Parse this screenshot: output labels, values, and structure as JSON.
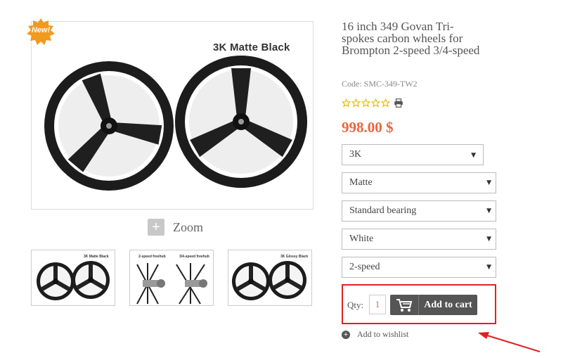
{
  "badge": {
    "label": "New!",
    "color": "#f29a1f"
  },
  "main_image": {
    "caption": "3K Matte Black"
  },
  "zoom": {
    "label": "Zoom"
  },
  "thumbnails": [
    {
      "caption_left": "",
      "caption_right": "3K Matte Black"
    },
    {
      "caption_left": "2-speed freehub",
      "caption_right": "3/4-speed freehub"
    },
    {
      "caption_left": "",
      "caption_right": "3K Glossy Black"
    }
  ],
  "product": {
    "title": "16 inch 349 Govan Tri-spokes carbon wheels for Brompton 2-speed 3/4-speed",
    "code": "Code: SMC-349-TW2",
    "rating_stars": 0,
    "rating_max": 5,
    "price": "998.00 $",
    "price_color": "#e9663d"
  },
  "options": [
    {
      "selected": "3K"
    },
    {
      "selected": "Matte"
    },
    {
      "selected": "Standard bearing"
    },
    {
      "selected": "White"
    },
    {
      "selected": "2-speed"
    }
  ],
  "cart": {
    "qty_label": "Qty:",
    "qty_value": "1",
    "add_label": "Add to cart",
    "highlight_color": "#e02020"
  },
  "wishlist": {
    "label": "Add to wishlist"
  }
}
